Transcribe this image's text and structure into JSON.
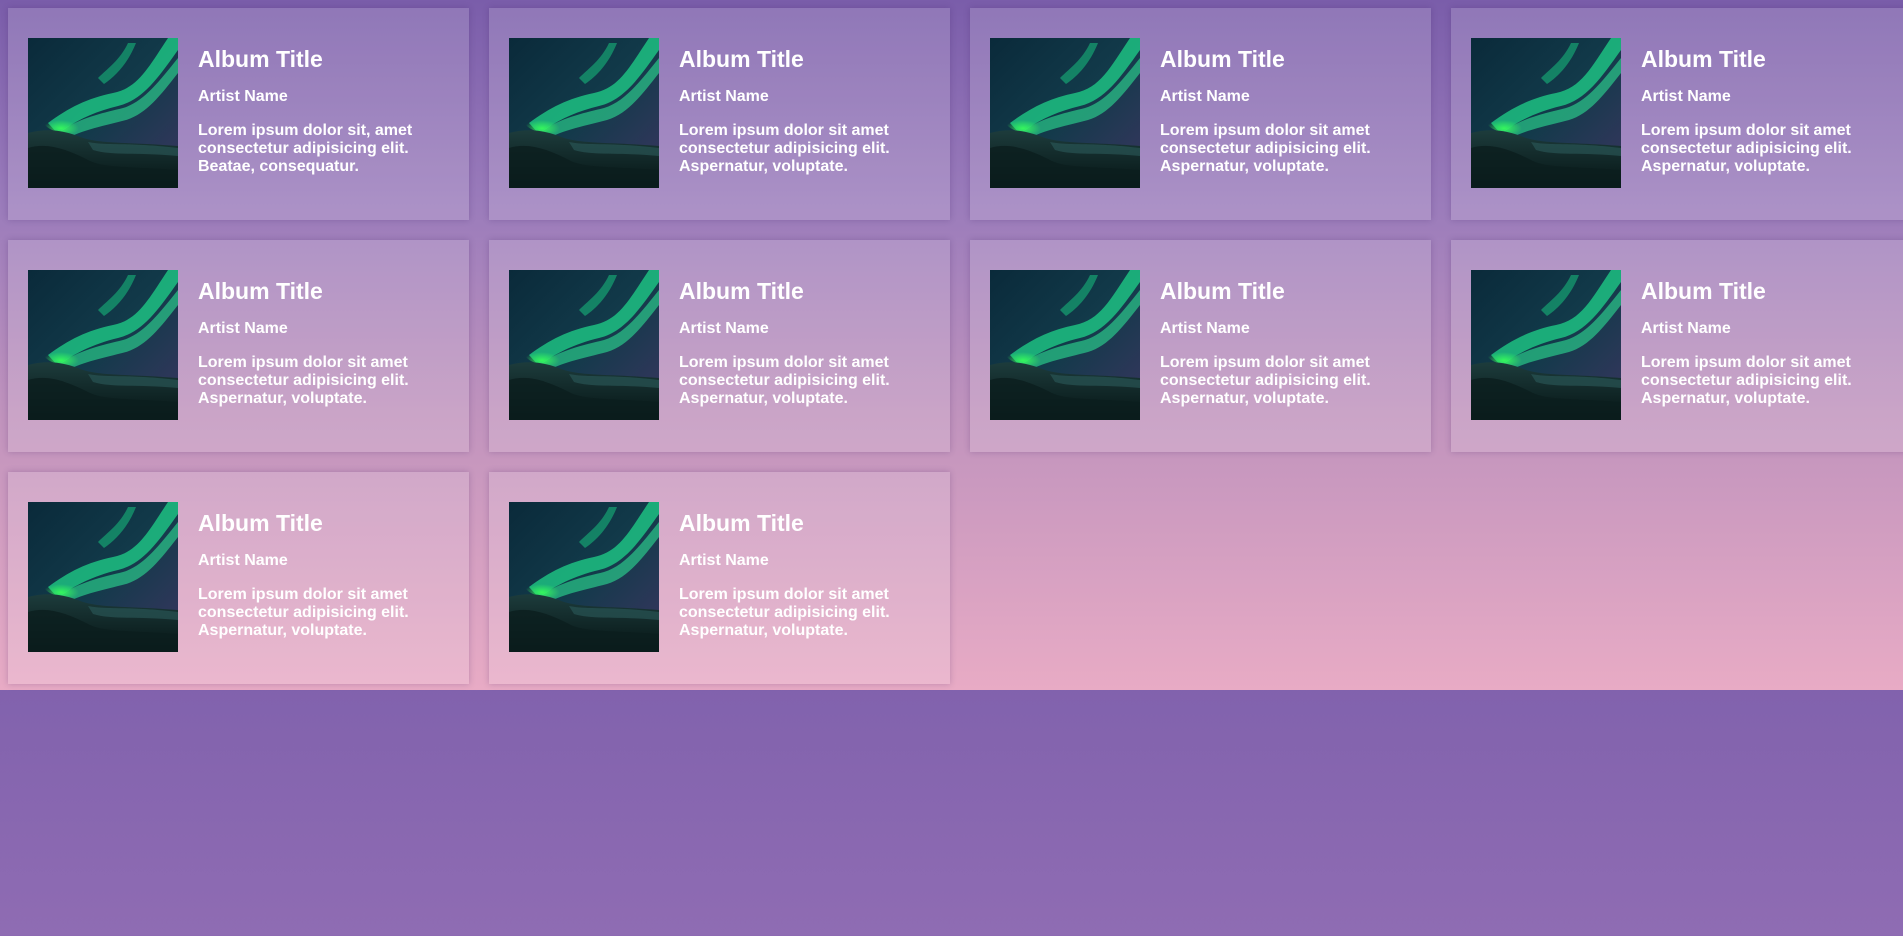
{
  "albums": [
    {
      "title": "Album Title",
      "artist": "Artist Name",
      "description": "Lorem ipsum dolor sit, amet consectetur adipisicing elit. Beatae, consequatur."
    },
    {
      "title": "Album Title",
      "artist": "Artist Name",
      "description": "Lorem ipsum dolor sit amet consectetur adipisicing elit. Aspernatur, voluptate."
    },
    {
      "title": "Album Title",
      "artist": "Artist Name",
      "description": "Lorem ipsum dolor sit amet consectetur adipisicing elit. Aspernatur, voluptate."
    },
    {
      "title": "Album Title",
      "artist": "Artist Name",
      "description": "Lorem ipsum dolor sit amet consectetur adipisicing elit. Aspernatur, voluptate."
    },
    {
      "title": "Album Title",
      "artist": "Artist Name",
      "description": "Lorem ipsum dolor sit amet consectetur adipisicing elit. Aspernatur, voluptate."
    },
    {
      "title": "Album Title",
      "artist": "Artist Name",
      "description": "Lorem ipsum dolor sit amet consectetur adipisicing elit. Aspernatur, voluptate."
    },
    {
      "title": "Album Title",
      "artist": "Artist Name",
      "description": "Lorem ipsum dolor sit amet consectetur adipisicing elit. Aspernatur, voluptate."
    },
    {
      "title": "Album Title",
      "artist": "Artist Name",
      "description": "Lorem ipsum dolor sit amet consectetur adipisicing elit. Aspernatur, voluptate."
    },
    {
      "title": "Album Title",
      "artist": "Artist Name",
      "description": "Lorem ipsum dolor sit amet consectetur adipisicing elit. Aspernatur, voluptate."
    },
    {
      "title": "Album Title",
      "artist": "Artist Name",
      "description": "Lorem ipsum dolor sit amet consectetur adipisicing elit. Aspernatur, voluptate."
    }
  ],
  "cover_image": "aurora-photo",
  "colors": {
    "text": "#ffffff",
    "gradient_top": "#7a5daa",
    "gradient_bottom": "#e8abc5",
    "page_background": "#6a4fa3"
  }
}
